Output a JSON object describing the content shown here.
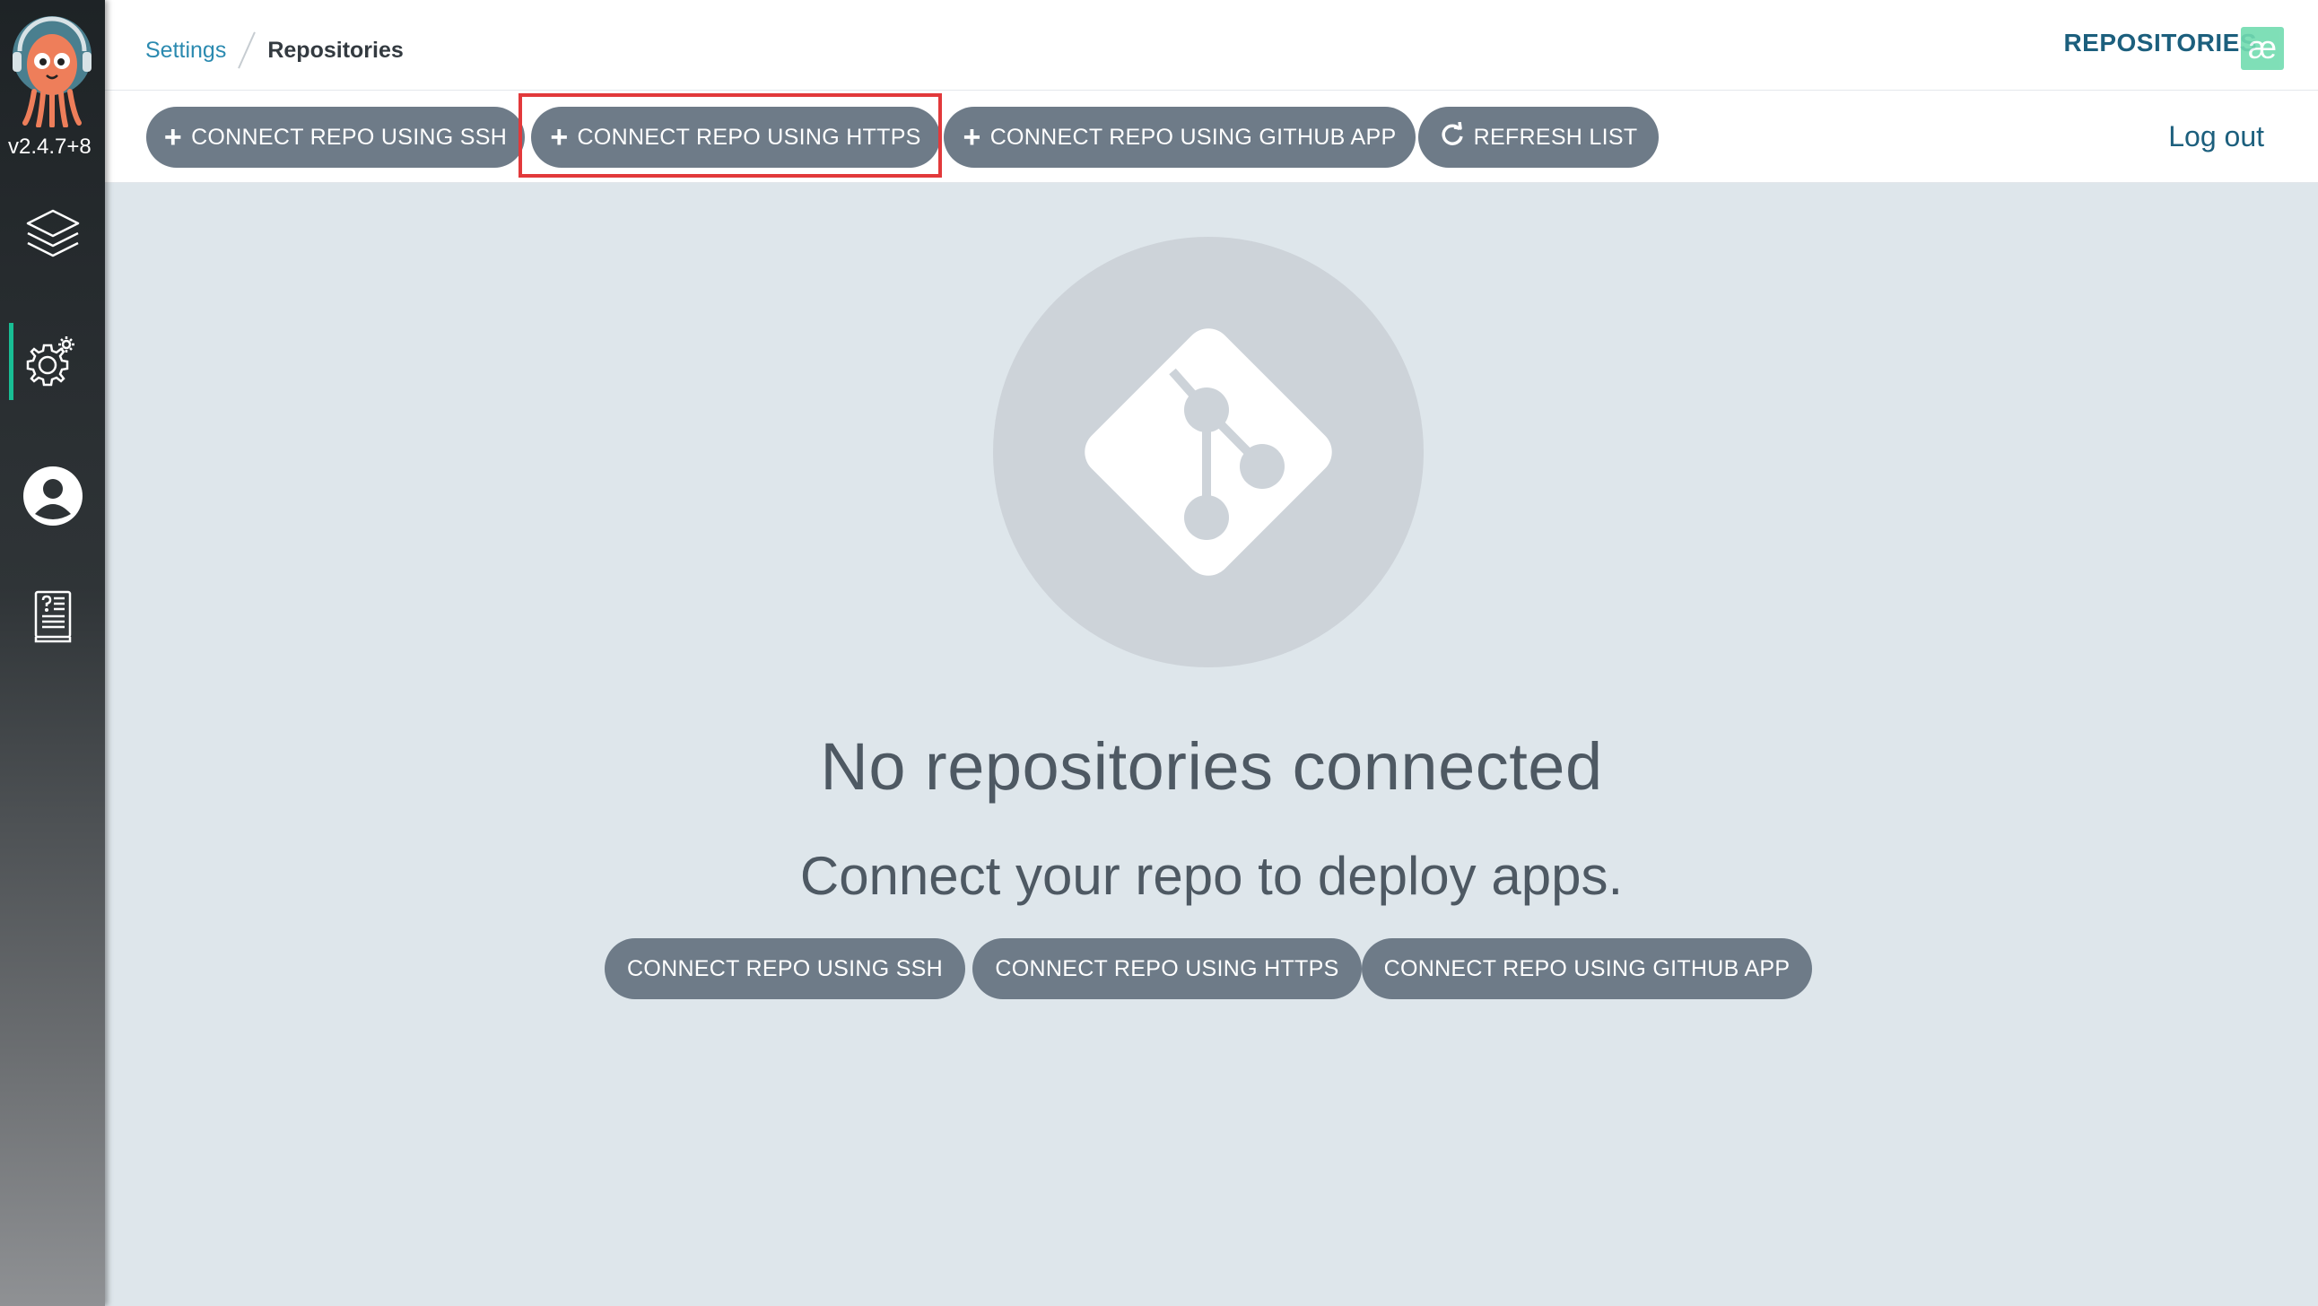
{
  "sidebar": {
    "version": "v2.4.7+8",
    "items": [
      {
        "name": "applications",
        "icon": "layers-icon"
      },
      {
        "name": "settings",
        "icon": "gear-icon",
        "active": true
      },
      {
        "name": "user-info",
        "icon": "user-icon"
      },
      {
        "name": "documentation",
        "icon": "docs-icon"
      }
    ]
  },
  "header": {
    "breadcrumb": {
      "parent": "Settings",
      "current": "Repositories"
    },
    "title": "REPOSITORIES",
    "badge": "æ"
  },
  "toolbar": {
    "ssh_label": "CONNECT REPO USING SSH",
    "https_label": "CONNECT REPO USING HTTPS",
    "github_label": "CONNECT REPO USING GITHUB APP",
    "refresh_label": "REFRESH LIST",
    "logout_label": "Log out"
  },
  "empty": {
    "title": "No repositories connected",
    "subtitle": "Connect your repo to deploy apps.",
    "ssh_label": "CONNECT REPO USING SSH",
    "https_label": "CONNECT REPO USING HTTPS",
    "github_label": "CONNECT REPO USING GITHUB APP"
  },
  "colors": {
    "button": "#6e7b88",
    "accent": "#1c5f7d",
    "highlight": "#e2393b",
    "active_indicator": "#18be94"
  }
}
